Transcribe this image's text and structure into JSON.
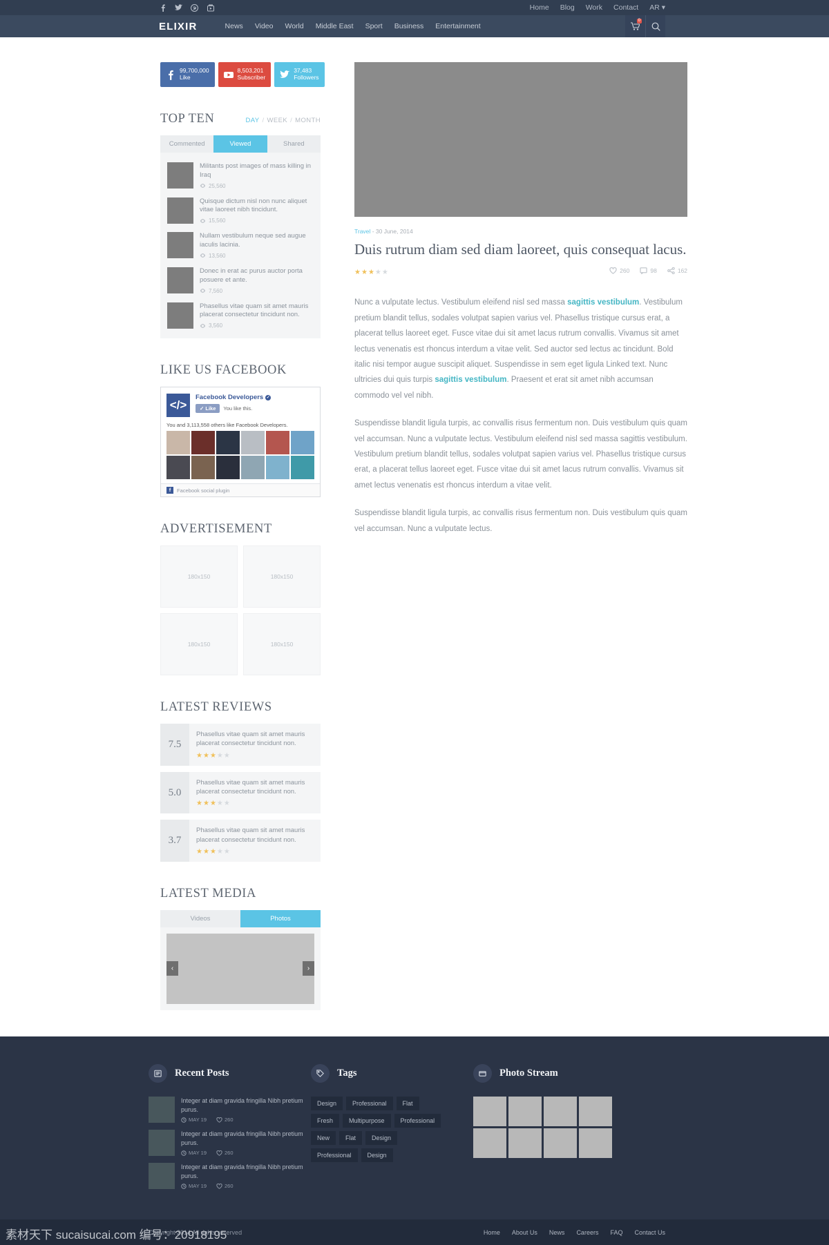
{
  "topbar": {
    "social": [
      {
        "name": "facebook-icon",
        "glyph": "f"
      },
      {
        "name": "twitter-icon",
        "glyph": "t"
      },
      {
        "name": "pinterest-icon",
        "glyph": "p"
      },
      {
        "name": "youtube-icon",
        "glyph": "y"
      }
    ],
    "links": [
      "Home",
      "Blog",
      "Work",
      "Contact"
    ],
    "language": "AR"
  },
  "nav": {
    "brand": "ELIXIR",
    "links": [
      "News",
      "Video",
      "World",
      "Middle East",
      "Sport",
      "Business",
      "Entertainment"
    ],
    "cart_count": "0",
    "cart_icon": "cart-icon",
    "search_icon": "search-icon"
  },
  "counters": [
    {
      "icon": "facebook-icon",
      "number": "99,700,000",
      "label": "Like",
      "color": "#4a6ea9"
    },
    {
      "icon": "youtube-icon",
      "number": "8,503,201",
      "label": "Subscriber",
      "color": "#dc4b40"
    },
    {
      "icon": "twitter-icon",
      "number": "37,483",
      "label": "Followers",
      "color": "#5bc4e5"
    }
  ],
  "topten": {
    "title": "TOP TEN",
    "filters": [
      "DAY",
      "WEEK",
      "MONTH"
    ],
    "active_filter": "DAY",
    "tabs": [
      "Commented",
      "Viewed",
      "Shared"
    ],
    "active_tab": "Viewed",
    "items": [
      {
        "text": "Militants post images of mass killing in Iraq",
        "views": "25,560"
      },
      {
        "text": "Quisque dictum nisl non nunc aliquet vitae laoreet nibh tincidunt.",
        "views": "15,560"
      },
      {
        "text": "Nullam vestibulum neque sed augue iaculis lacinia.",
        "views": "13,560"
      },
      {
        "text": "Donec in erat ac purus auctor porta posuere et ante.",
        "views": "7,560"
      },
      {
        "text": "Phasellus vitae quam sit amet mauris placerat consectetur tincidunt non.",
        "views": "3,560"
      }
    ]
  },
  "facebook": {
    "title": "LIKE US FACEBOOK",
    "page_name": "Facebook Developers",
    "like_button": "Like",
    "like_note": "You like this.",
    "sub": "You and 3,113,558 others like Facebook Developers.",
    "footer": "Facebook social plugin",
    "faces": [
      "#c9b7a8",
      "#6b2f2a",
      "#2b3545",
      "#b9bec4",
      "#b4564f",
      "#6fa3c8",
      "#4a4a52",
      "#7a6350",
      "#2a2f3c",
      "#8fa6b3",
      "#7fb2cd",
      "#3f9aa8"
    ]
  },
  "advertisement": {
    "title": "ADVERTISEMENT",
    "slots": [
      "180x150",
      "180x150",
      "180x150",
      "180x150"
    ]
  },
  "reviews": {
    "title": "LATEST REVIEWS",
    "items": [
      {
        "score": "7.5",
        "text": "Phasellus vitae quam sit amet mauris placerat consectetur tincidunt non.",
        "stars": 3
      },
      {
        "score": "5.0",
        "text": "Phasellus vitae quam sit amet mauris placerat consectetur tincidunt non.",
        "stars": 3
      },
      {
        "score": "3.7",
        "text": "Phasellus vitae quam sit amet mauris placerat consectetur tincidunt non.",
        "stars": 3
      }
    ]
  },
  "media": {
    "title": "LATEST MEDIA",
    "tabs": [
      "Videos",
      "Photos"
    ],
    "active_tab": "Photos",
    "prev": "‹",
    "next": "›"
  },
  "article": {
    "category": "Travel",
    "date": "- 30 June, 2014",
    "title": "Duis rutrum diam sed diam laoreet, quis consequat lacus.",
    "stars": 3,
    "likes": "260",
    "comments": "98",
    "shares": "162",
    "p1_a": "Nunc a vulputate lectus. Vestibulum eleifend nisl sed massa ",
    "p1_link1": "sagittis vestibulum",
    "p1_b": ". Vestibulum pretium blandit tellus, sodales volutpat sapien varius vel. Phasellus tristique cursus erat, a placerat tellus laoreet eget. Fusce vitae dui sit amet lacus rutrum convallis. Vivamus sit amet lectus venenatis est rhoncus interdum a vitae velit. Sed auctor sed lectus ac tincidunt. Bold italic nisi tempor augue suscipit aliquet. Suspendisse in sem eget ligula Linked text. Nunc ultricies dui quis turpis ",
    "p1_link2": "sagittis vestibulum",
    "p1_c": ". Praesent et erat sit amet nibh accumsan commodo vel vel nibh.",
    "p2": "Suspendisse blandit ligula turpis, ac convallis risus fermentum non. Duis vestibulum quis quam vel accumsan. Nunc a vulputate lectus. Vestibulum eleifend nisl sed massa sagittis vestibulum. Vestibulum pretium blandit tellus, sodales volutpat sapien varius vel. Phasellus tristique cursus erat, a placerat tellus laoreet eget. Fusce vitae dui sit amet lacus rutrum convallis. Vivamus sit amet lectus venenatis est rhoncus interdum a vitae velit.",
    "p3": "Suspendisse blandit ligula turpis, ac convallis risus fermentum non. Duis vestibulum quis quam vel accumsan. Nunc a vulputate lectus."
  },
  "footer": {
    "recent": {
      "title": "Recent Posts",
      "icon": "newspaper-icon",
      "items": [
        {
          "text": "Integer at diam gravida fringilla Nibh pretium purus.",
          "date": "MAY 19",
          "likes": "260"
        },
        {
          "text": "Integer at diam gravida fringilla Nibh pretium purus.",
          "date": "MAY 19",
          "likes": "260"
        },
        {
          "text": "Integer at diam gravida fringilla Nibh pretium purus.",
          "date": "MAY 19",
          "likes": "260"
        }
      ]
    },
    "tags": {
      "title": "Tags",
      "icon": "tag-icon",
      "items": [
        "Design",
        "Professional",
        "Flat",
        "Fresh",
        "Multipurpose",
        "Professional",
        "New",
        "Flat",
        "Design",
        "Professional",
        "Design"
      ]
    },
    "photostream": {
      "title": "Photo Stream",
      "icon": "photo-icon",
      "count": 8
    },
    "copyright": "Copyright 2014 All rights reserved",
    "links": [
      "Home",
      "About Us",
      "News",
      "Careers",
      "FAQ",
      "Contact Us"
    ]
  },
  "watermark": {
    "line": "素材天下 sucaisucai.com 编号：20918195"
  }
}
